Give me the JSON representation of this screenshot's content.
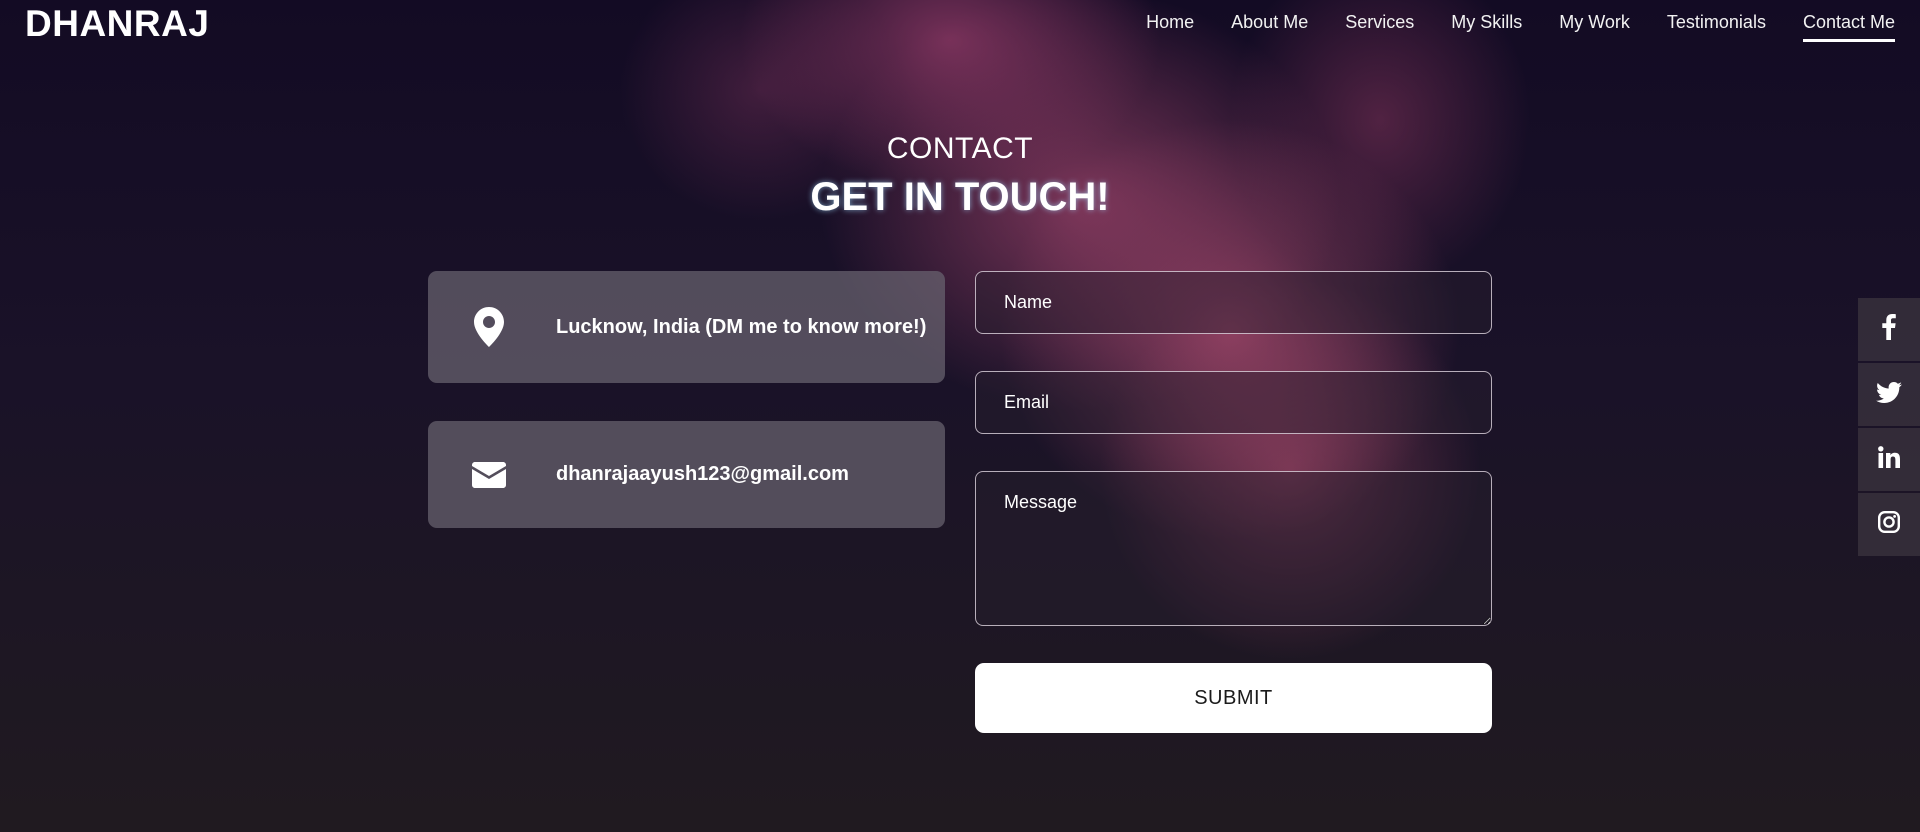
{
  "brand": {
    "name": "DHANRAJ"
  },
  "nav": {
    "items": [
      {
        "label": "Home",
        "active": false
      },
      {
        "label": "About Me",
        "active": false
      },
      {
        "label": "Services",
        "active": false
      },
      {
        "label": "My Skills",
        "active": false
      },
      {
        "label": "My Work",
        "active": false
      },
      {
        "label": "Testimonials",
        "active": false
      },
      {
        "label": "Contact Me",
        "active": true
      }
    ]
  },
  "section": {
    "subtitle": "CONTACT",
    "title": "GET IN TOUCH!"
  },
  "contact_info": {
    "location": {
      "icon": "map-pin-icon",
      "text": "Lucknow, India (DM me to know more!)"
    },
    "email": {
      "icon": "envelope-icon",
      "text": "dhanrajaayush123@gmail.com"
    }
  },
  "form": {
    "name_placeholder": "Name",
    "email_placeholder": "Email",
    "message_placeholder": "Message",
    "submit_label": "SUBMIT"
  },
  "social": {
    "icons": [
      "facebook-icon",
      "twitter-icon",
      "linkedin-icon",
      "instagram-icon"
    ]
  },
  "colors": {
    "background": "#140f1e",
    "accent_smoke": "#a5466e",
    "card": "#69647a",
    "text": "#ffffff"
  }
}
